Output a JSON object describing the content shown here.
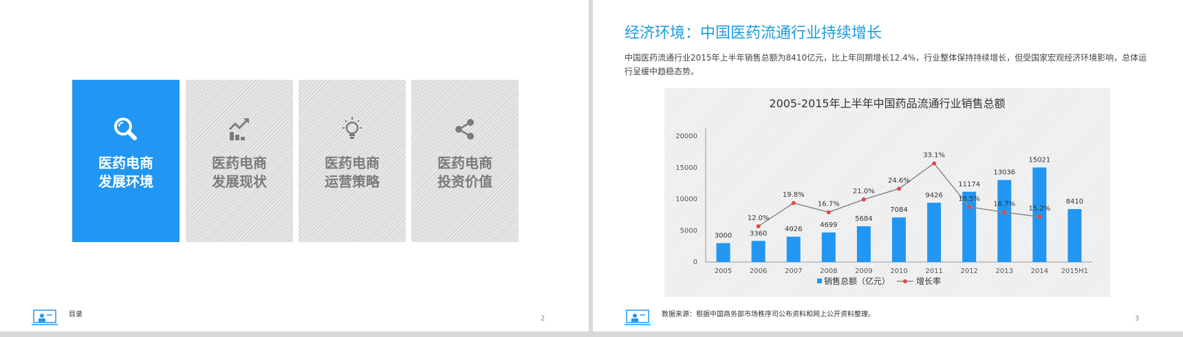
{
  "left_slide": {
    "tiles": [
      {
        "title": "医药电商\n发展环境",
        "icon": "search-icon",
        "active": true
      },
      {
        "title": "医药电商\n发展现状",
        "icon": "growth-chart-icon",
        "active": false
      },
      {
        "title": "医药电商\n运营策略",
        "icon": "lightbulb-icon",
        "active": false
      },
      {
        "title": "医药电商\n投资价值",
        "icon": "share-icon",
        "active": false
      }
    ],
    "footer_label": "目录",
    "page_number": "2"
  },
  "right_slide": {
    "heading": "经济环境：中国医药流通行业持续增长",
    "paragraph": "中国医药流通行业2015年上半年销售总额为8410亿元，比上年同期增长12.4%，行业整体保持持续增长，但受国家宏观经济环境影响，总体运行呈缓中趋稳态势。",
    "source_note": "数据来源：根据中国商务部市场秩序司公布资料和网上公开资料整理。",
    "page_number": "3"
  },
  "colors": {
    "accent": "#2196f3",
    "heading": "#1a9be0",
    "line": "#888888",
    "marker": "#e94545",
    "tile_gray": "#e7e7e7"
  },
  "chart_data": {
    "type": "bar",
    "title": "2005-2015年上半年中国药品流通行业销售总额",
    "categories": [
      "2005",
      "2006",
      "2007",
      "2008",
      "2009",
      "2010",
      "2011",
      "2012",
      "2013",
      "2014",
      "2015H1"
    ],
    "series": [
      {
        "name": "销售总额（亿元）",
        "type": "bar",
        "values": [
          3000,
          3360,
          4026,
          4699,
          5684,
          7084,
          9426,
          11174,
          13036,
          15021,
          8410
        ]
      },
      {
        "name": "增长率",
        "type": "line",
        "values": [
          null,
          12.0,
          19.8,
          16.7,
          21.0,
          24.6,
          33.1,
          18.5,
          16.7,
          15.2,
          null
        ],
        "labels": [
          "",
          "12.0%",
          "19.8%",
          "16.7%",
          "21.0%",
          "24.6%",
          "33.1%",
          "18.5%",
          "16.7%",
          "15.2%",
          ""
        ]
      }
    ],
    "y_ticks": [
      0,
      5000,
      10000,
      15000,
      20000
    ],
    "ylim": [
      0,
      20000
    ],
    "legend_position": "bottom"
  }
}
